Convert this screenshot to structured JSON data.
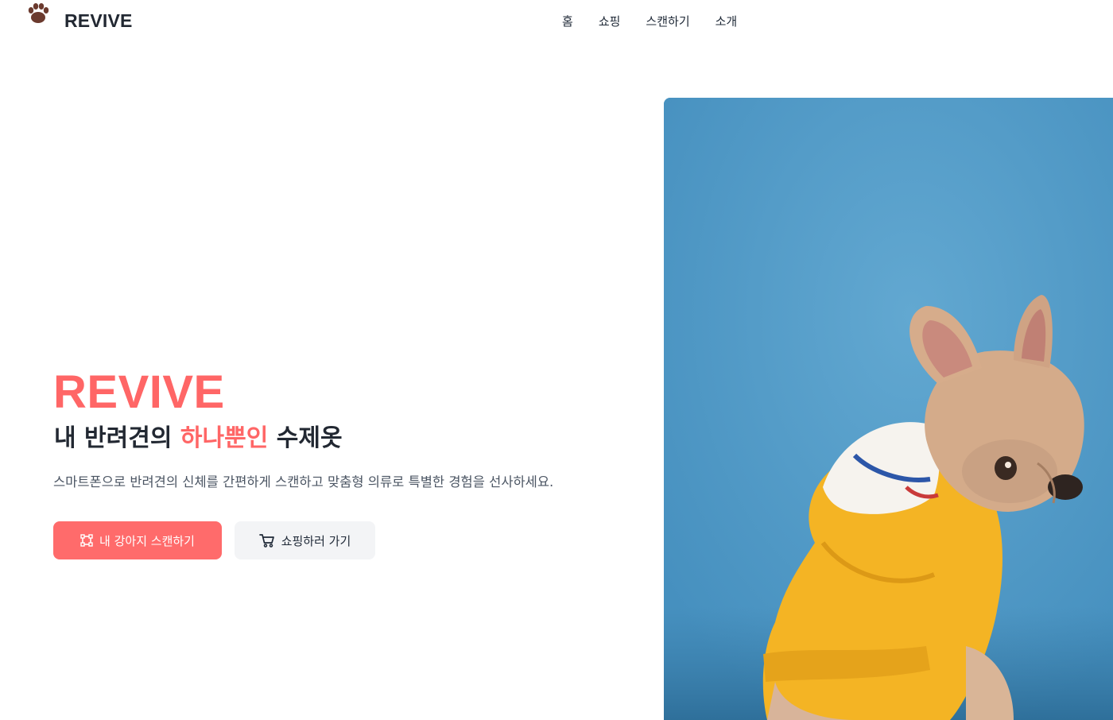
{
  "header": {
    "brand": "REVIVE",
    "logo_icon": "paw-icon",
    "nav": [
      {
        "label": "홈"
      },
      {
        "label": "쇼핑"
      },
      {
        "label": "스캔하기"
      },
      {
        "label": "소개"
      }
    ]
  },
  "hero": {
    "title": "REVIVE",
    "subtitle_before": "내 반려견의 ",
    "subtitle_highlight": "하나뿐인",
    "subtitle_after": " 수제옷",
    "description": "스마트폰으로 반려견의 신체를 간편하게 스캔하고 맞춤형 의류로 특별한 경험을 선사하세요.",
    "primary_button": {
      "label": "내 강아지 스캔하기",
      "icon": "scan-frame-icon"
    },
    "secondary_button": {
      "label": "쇼핑하러 가기",
      "icon": "cart-icon"
    },
    "image": "French bulldog wearing a yellow hoodie on a blue background"
  },
  "colors": {
    "accent": "#ff6b6b",
    "text": "#1f2937",
    "muted": "#4b5563",
    "secondary_bg": "#f3f4f6",
    "image_bg": "#4f9ac6"
  }
}
